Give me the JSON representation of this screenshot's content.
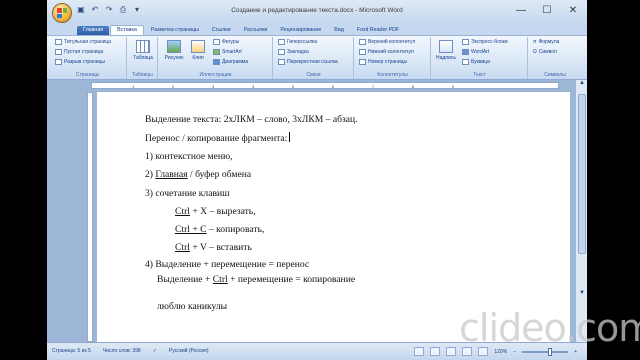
{
  "window": {
    "title": "Создание и редактирование текста.docx - Microsoft Word",
    "minimize": "—",
    "maximize": "☐",
    "close": "✕"
  },
  "quick_access": [
    "save-icon",
    "undo-icon",
    "redo-icon",
    "print-icon",
    "customize-icon"
  ],
  "tabs": [
    "Главная",
    "Вставка",
    "Разметка страницы",
    "Ссылки",
    "Рассылки",
    "Рецензирование",
    "Вид",
    "Foxit Reader PDF"
  ],
  "active_tab": "Вставка",
  "ribbon": {
    "pages": {
      "items": [
        "Титульная страница",
        "Пустая страница",
        "Разрыв страницы"
      ],
      "label": "Страницы"
    },
    "tables": {
      "button": "Таблица",
      "label": "Таблицы"
    },
    "illustrations": {
      "buttons": [
        "Рисунок",
        "Клип"
      ],
      "items": [
        "Фигуры",
        "SmartArt",
        "Диаграмма"
      ],
      "label": "Иллюстрации"
    },
    "links": {
      "items": [
        "Гиперссылка",
        "Закладка",
        "Перекрестная ссылка"
      ],
      "label": "Связи"
    },
    "header_footer": {
      "items": [
        "Верхний колонтитул",
        "Нижний колонтитул",
        "Номер страницы"
      ],
      "label": "Колонтитулы"
    },
    "text": {
      "button": "Надпись",
      "items": [
        "Экспресс-блоки",
        "WordArt",
        "Буквица"
      ],
      "label": "Текст"
    },
    "symbols": {
      "items": [
        "Формула",
        "Символ"
      ],
      "label": "Символы"
    }
  },
  "document": {
    "l1": "Выделение текста: 2хЛКМ – слово, 3хЛКМ – абзац.",
    "l2": "Перенос / копирование фрагмента:",
    "l3": "1) контекстное меню,",
    "l4a": "2) ",
    "l4b": "Главная",
    "l4c": " / буфер обмена",
    "l5": "3) сочетание клавиш",
    "l6a": "Ctrl",
    "l6b": " + X – вырезать,",
    "l7a": "Ctrl + C",
    "l7b": " – копировать,",
    "l8a": "Ctrl",
    "l8b": " + V – вставить",
    "l9": "4) Выделение + перемещение = перенос",
    "l10a": "Выделение + ",
    "l10b": "Ctrl",
    "l10c": " + перемещение = копирование",
    "l11": "люблю каникулы"
  },
  "status": {
    "page": "Страница: 5 из 5",
    "words": "Число слов: 398",
    "lang": "Русский (Россия)",
    "zoom": "120%",
    "zoom_minus": "−",
    "zoom_plus": "+"
  },
  "watermark": "clideo.com"
}
